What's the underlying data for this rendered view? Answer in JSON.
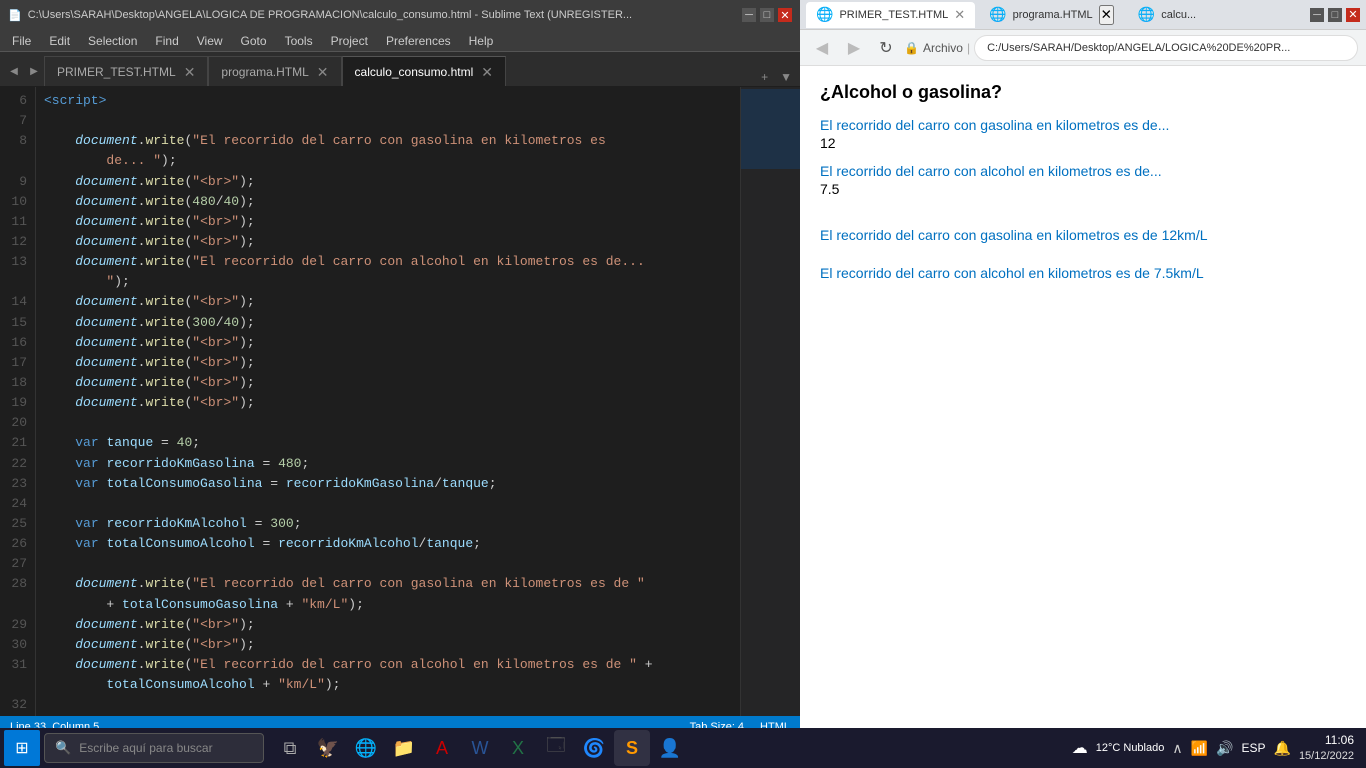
{
  "editor": {
    "title": "C:\\Users\\SARAH\\Desktop\\ANGELA\\LOGICA DE PROGRAMACION\\calculo_consumo.html - Sublime Text (UNREGISTER...",
    "tabs": [
      {
        "label": "PRIMER_TEST.HTML",
        "active": false
      },
      {
        "label": "programa.HTML",
        "active": false
      },
      {
        "label": "calculo_consumo.html",
        "active": true
      }
    ],
    "menu": [
      "File",
      "Edit",
      "Selection",
      "Find",
      "View",
      "Goto",
      "Tools",
      "Project",
      "Preferences",
      "Help"
    ],
    "status": {
      "line_col": "Line 33, Column 5",
      "tab_size": "Tab Size: 4",
      "syntax": "HTML"
    }
  },
  "browser": {
    "tabs": [
      {
        "label": "PRIMER_TEST.HTML",
        "active": false
      },
      {
        "label": "programa.HTML",
        "active": false
      },
      {
        "label": "calcu...",
        "active": false
      }
    ],
    "address": "C:/Users/SARAH/Desktop/ANGELA/LOGICA%20DE%20PR...",
    "title": "¿Alcohol o gasolina?",
    "content": [
      {
        "type": "blue",
        "text": "El recorrido del carro con gasolina en kilometros es de..."
      },
      {
        "type": "black",
        "text": "12"
      },
      {
        "type": "blue",
        "text": "El recorrido del carro con alcohol en kilometros es de..."
      },
      {
        "type": "black",
        "text": "7.5"
      },
      {
        "type": "spacer"
      },
      {
        "type": "blue",
        "text": "El recorrido del carro con gasolina en kilometros es de 12km/L"
      },
      {
        "type": "spacer_small"
      },
      {
        "type": "blue",
        "text": "El recorrido del carro con alcohol en kilometros es de 7.5km/L"
      }
    ]
  },
  "taskbar": {
    "search_placeholder": "Escribe aquí para buscar",
    "time": "11:06",
    "date": "15/12/2022",
    "weather": "12°C Nublado",
    "language": "ESP"
  }
}
